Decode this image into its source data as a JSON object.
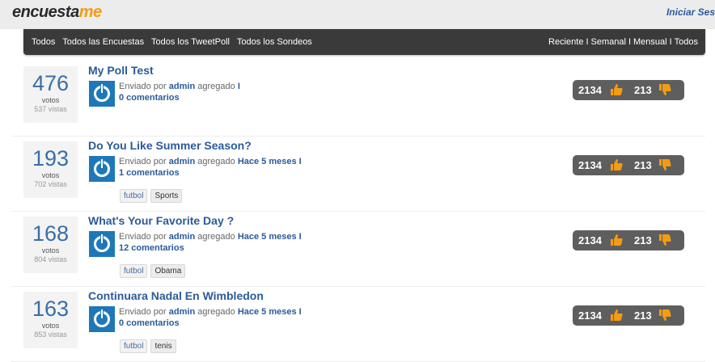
{
  "header": {
    "logo_part1": "encuesta",
    "logo_part2": "me",
    "login_label": "Iniciar Ses"
  },
  "nav": {
    "left": [
      "Todos",
      "Todos las Encuestas",
      "Todos los TweetPoll",
      "Todos los Sondeos"
    ],
    "right": [
      "Reciente",
      "Semanal",
      "Mensual",
      "Todos"
    ],
    "separator": "I"
  },
  "labels": {
    "votes": "votos",
    "sent_by": "Enviado por",
    "added": "agregado"
  },
  "polls": [
    {
      "votes": "476",
      "views": "537 vistas",
      "title": "My Poll Test",
      "author": "admin",
      "time": "I",
      "comments": "0 comentarios",
      "tags": [],
      "likes": "2134",
      "dislikes": "213"
    },
    {
      "votes": "193",
      "views": "702 vistas",
      "title": "Do You Like Summer Season?",
      "author": "admin",
      "time": "Hace 5 meses I",
      "comments": "1 comentarios",
      "tags": [
        "futbol",
        "Sports"
      ],
      "likes": "2134",
      "dislikes": "213"
    },
    {
      "votes": "168",
      "views": "804 vistas",
      "title": "What's Your Favorite Day ?",
      "author": "admin",
      "time": "Hace 5 meses I",
      "comments": "12 comentarios",
      "tags": [
        "futbol",
        "Obama"
      ],
      "likes": "2134",
      "dislikes": "213"
    },
    {
      "votes": "163",
      "views": "853 vistas",
      "title": "Continuara Nadal En Wimbledon",
      "author": "admin",
      "time": "Hace 5 meses I",
      "comments": "0 comentarios",
      "tags": [
        "futbol",
        "tenis"
      ],
      "likes": "2134",
      "dislikes": "213"
    }
  ],
  "colors": {
    "accent": "#f39c12",
    "link": "#2a5a9a",
    "nav_bg": "#3a3a3a",
    "rating_bg": "#5e5e5e"
  }
}
